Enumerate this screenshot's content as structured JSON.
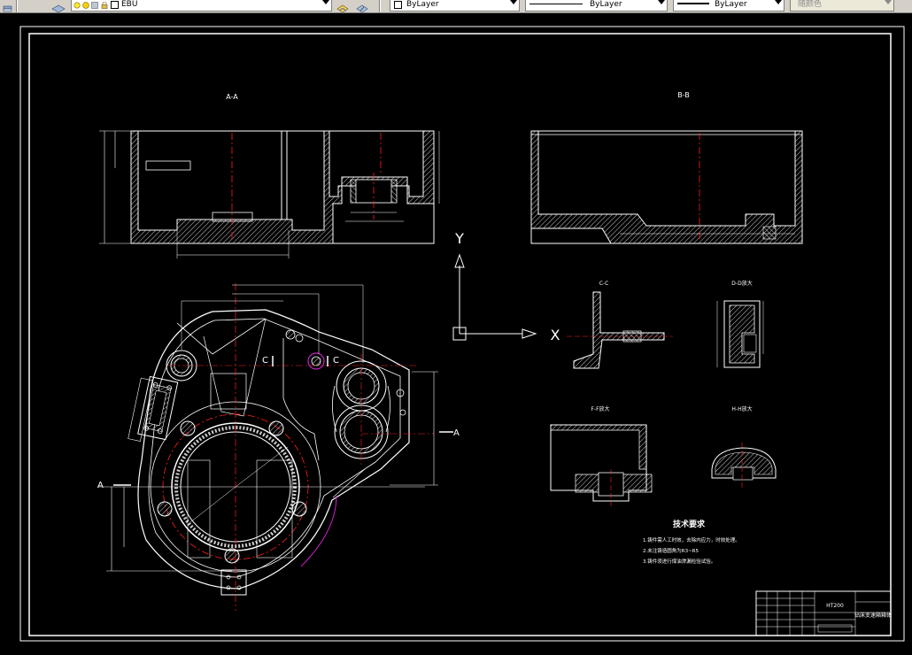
{
  "toolbar": {
    "layer_name": "EBU",
    "color_value": "ByLayer",
    "linetype_value": "ByLayer",
    "lineweight_value": "ByLayer",
    "plotstyle_value": "随颜色"
  },
  "drawing": {
    "view_aa_label": "A-A",
    "view_bb_label": "B-B",
    "section_cc_label": "C-C",
    "detail_d_label": "D-D放大",
    "detail_f_label": "F-F放大",
    "detail_h_label": "H-H放大",
    "ucs_y_label": "Y",
    "ucs_x_label": "X",
    "cut_a_left": "A",
    "cut_a_right": "A",
    "cut_c_left": "C",
    "cut_c_right": "C",
    "tech_title": "技术要求",
    "tech_notes": [
      "1.铸件需人工时效，去除内应力，时效处理。",
      "2.未注铸造圆角为R3~R5",
      "3.铸件须进行煤油渗漏检验试验。"
    ],
    "title_block_material": "HT200",
    "title_block_name": "钻床变速箱箱体"
  }
}
